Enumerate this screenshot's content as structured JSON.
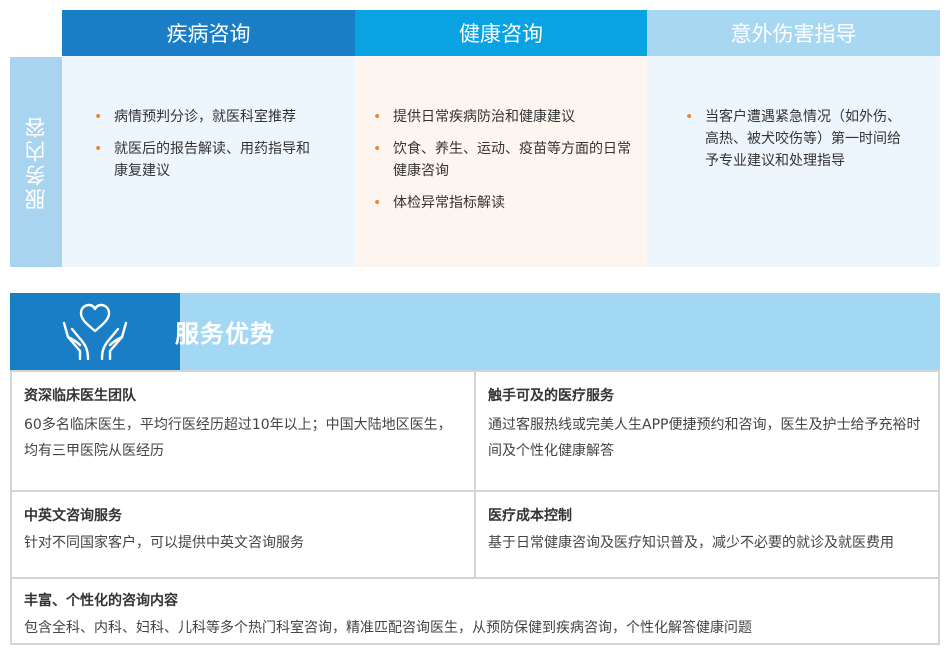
{
  "service_content": {
    "side_label": "服务内容",
    "columns": [
      {
        "title": "疾病咨询",
        "items": [
          "病情预判分诊，就医科室推荐",
          "就医后的报告解读、用药指导和康复建议"
        ]
      },
      {
        "title": "健康咨询",
        "items": [
          "提供日常疾病防治和健康建议",
          "饮食、养生、运动、疫苗等方面的日常健康咨询",
          "体检异常指标解读"
        ]
      },
      {
        "title": "意外伤害指导",
        "items": [
          "当客户遭遇紧急情况（如外伤、高热、被犬咬伤等）第一时间给予专业建议和处理指导"
        ]
      }
    ]
  },
  "advantages": {
    "title": "服务优势",
    "icon": "hands-heart-icon",
    "cells": [
      {
        "title": "资深临床医生团队",
        "text": "60多名临床医生，平均行医经历超过10年以上；中国大陆地区医生，均有三甲医院从医经历"
      },
      {
        "title": "触手可及的医疗服务",
        "text": "通过客服热线或完美人生APP便捷预约和咨询，医生及护士给予充裕时间及个性化健康解答"
      },
      {
        "title": "中英文咨询服务",
        "text": "针对不同国家客户，可以提供中英文咨询服务"
      },
      {
        "title": "医疗成本控制",
        "text": "基于日常健康咨询及医疗知识普及，减少不必要的就诊及就医费用"
      },
      {
        "title": "丰富、个性化的咨询内容",
        "text": "包含全科、内科、妇科、儿科等多个热门科室咨询，精准匹配咨询医生，从预防保健到疾病咨询，个性化解答健康问题"
      }
    ]
  },
  "colors": {
    "dark_blue": "#1a7ec6",
    "mid_blue": "#09a3e3",
    "light_blue": "#a8d7f2",
    "bullet_orange": "#e8883a"
  }
}
